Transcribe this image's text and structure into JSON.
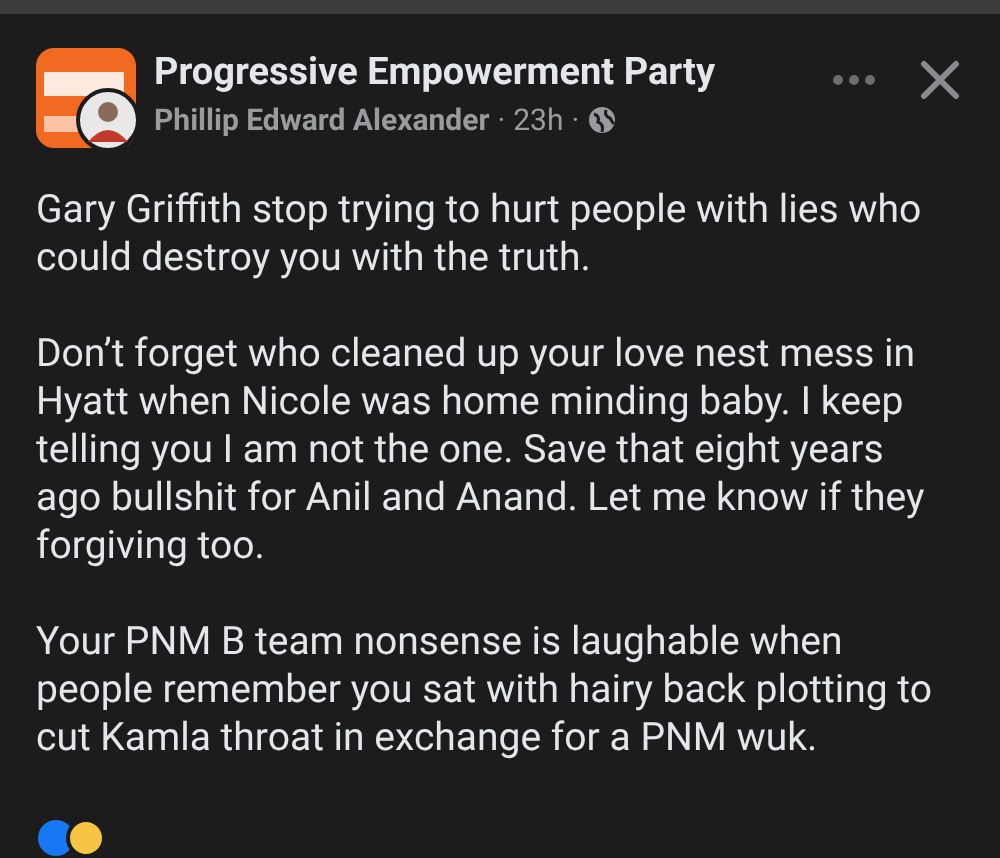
{
  "post": {
    "page_name": "Progressive Empowerment Party",
    "author": "Phillip Edward Alexander",
    "separator_1": "·",
    "time": "23h",
    "separator_2": "·",
    "paragraphs": [
      "Gary Griffith stop trying to hurt people with lies who could destroy you with the truth.",
      "Don’t forget who cleaned up your love nest mess in Hyatt when Nicole was home minding baby. I keep telling you I am not the one. Save that eight years ago bullshit for Anil and Anand. Let me know if they forgiving too.",
      "Your PNM B team nonsense is laughable when people remember you sat with hairy back plotting to cut Kamla throat in exchange for a PNM wuk."
    ]
  }
}
